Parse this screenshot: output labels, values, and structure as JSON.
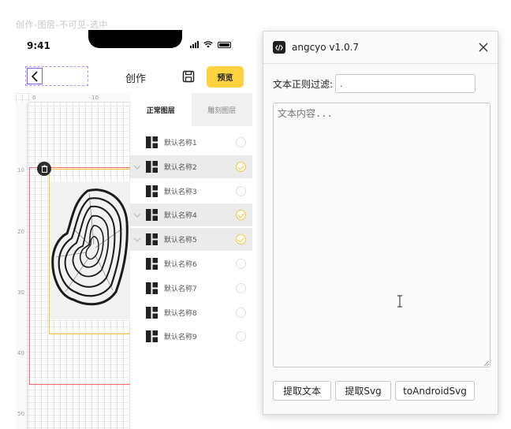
{
  "frame_title": "创作-图层-不可见-选中",
  "phone": {
    "status_time": "9:41",
    "nav_title": "创作",
    "preview_label": "预览",
    "ruler_top": [
      "0",
      "10"
    ],
    "ruler_left": [
      "10",
      "20",
      "30",
      "40",
      "50"
    ],
    "layers": {
      "tabs": [
        "正常图层",
        "雕刻图层"
      ],
      "active_tab": 0,
      "items": [
        {
          "name": "默认名称1",
          "selected": false
        },
        {
          "name": "默认名称2",
          "selected": true
        },
        {
          "name": "默认名称3",
          "selected": false
        },
        {
          "name": "默认名称4",
          "selected": true
        },
        {
          "name": "默认名称5",
          "selected": true
        },
        {
          "name": "默认名称6",
          "selected": false
        },
        {
          "name": "默认名称7",
          "selected": false
        },
        {
          "name": "默认名称8",
          "selected": false
        },
        {
          "name": "默认名称9",
          "selected": false
        }
      ]
    }
  },
  "dialog": {
    "title": "angcyo v1.0.7",
    "filter_label": "文本正则过滤:",
    "filter_value": ".",
    "content_placeholder": "文本内容...",
    "buttons": [
      "提取文本",
      "提取Svg",
      "toAndroidSvg"
    ]
  },
  "colors": {
    "accent_yellow": "#ffd23f",
    "selection_red": "#ff6b6b",
    "selection_yellow": "#f5c542",
    "back_purple": "#7b5cff"
  }
}
